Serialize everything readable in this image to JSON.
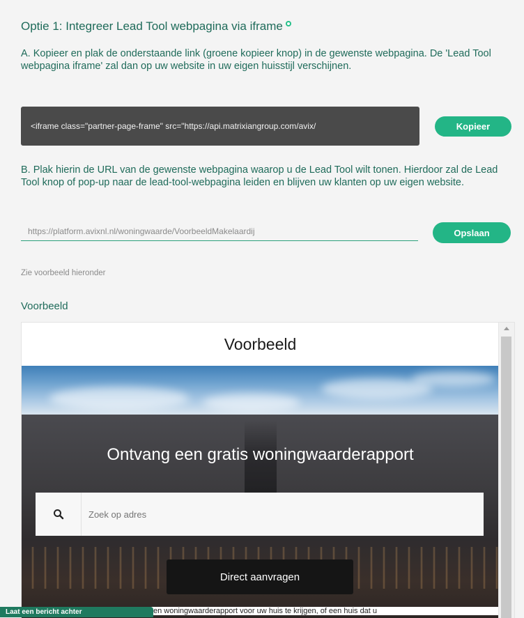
{
  "heading": {
    "title": "Optie 1: Integreer Lead Tool webpagina via iframe"
  },
  "step_a": {
    "text": "A. Kopieer en plak de onderstaande link (groene kopieer knop) in de gewenste webpagina. De 'Lead Tool webpagina iframe' zal dan op uw website in uw eigen huisstijl verschijnen.",
    "code": "<iframe class=\"partner-page-frame\" src=\"https://api.matrixiangroup.com/avix/",
    "copy_label": "Kopieer"
  },
  "step_b": {
    "text": "B. Plak hierin de URL van de gewenste webpagina waarop u de Lead Tool wilt tonen. Hierdoor zal de Lead Tool knop of pop-up naar de lead-tool-webpagina leiden en blijven uw klanten op uw eigen website.",
    "url_value": "https://platform.avixnl.nl/woningwaarde/VoorbeeldMakelaardij",
    "save_label": "Opslaan"
  },
  "example_hint": "Zie voorbeeld hieronder",
  "example_heading": "Voorbeeld",
  "preview": {
    "title": "Voorbeeld",
    "hero_title": "Ontvang een gratis woningwaarderapport",
    "search_placeholder": "Zoek op adres",
    "cta_label": "Direct aanvragen",
    "bottom_text": "en woningwaarderapport voor uw huis te krijgen, of een huis dat u"
  },
  "floating_tab": {
    "label": "Laat een bericht achter"
  },
  "colors": {
    "accent": "#23b586",
    "heading": "#1f6b5a",
    "code_bg": "#4a4a4a"
  }
}
